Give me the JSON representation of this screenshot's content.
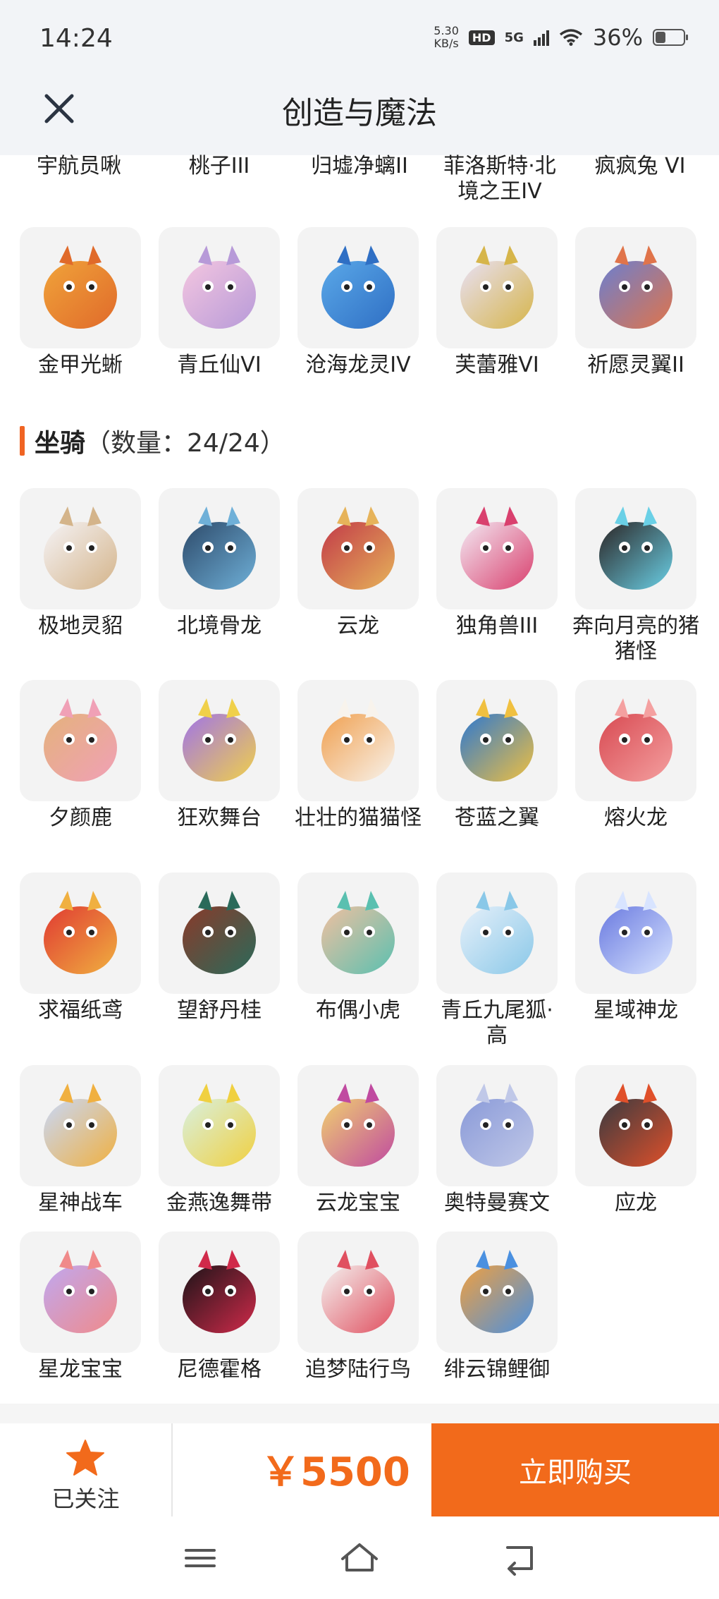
{
  "status_bar": {
    "time": "14:24",
    "net_speed_value": "5.30",
    "net_speed_unit": "KB/s",
    "hd": "HD",
    "network": "5G",
    "battery_pct": "36%",
    "battery_level": 0.36
  },
  "header": {
    "title": "创造与魔法"
  },
  "top_partial_labels": [
    "宇航员啾",
    "桃子III",
    "归墟净螭II",
    "菲洛斯特·北境之王IV",
    "疯疯兔 VI"
  ],
  "top_row": [
    {
      "label": "金甲光蜥",
      "icon": "golden-lizard-icon"
    },
    {
      "label": "青丘仙VI",
      "icon": "fox-fairy-icon"
    },
    {
      "label": "沧海龙灵IV",
      "icon": "sea-dragon-spirit-icon"
    },
    {
      "label": "芙蕾雅VI",
      "icon": "freya-icon"
    },
    {
      "label": "祈愿灵翼II",
      "icon": "griffin-icon"
    }
  ],
  "mounts_section": {
    "title": "坐骑",
    "count": "（数量：24/24）"
  },
  "mounts": [
    {
      "label": "极地灵貂",
      "icon": "polar-ferret-icon"
    },
    {
      "label": "北境骨龙",
      "icon": "bone-dragon-icon"
    },
    {
      "label": "云龙",
      "icon": "cloud-dragon-icon"
    },
    {
      "label": "独角兽III",
      "icon": "unicorn-icon"
    },
    {
      "label": "奔向月亮的猪猪怪",
      "icon": "pig-icon"
    },
    {
      "label": "夕颜鹿",
      "icon": "deer-icon"
    },
    {
      "label": "狂欢舞台",
      "icon": "carnival-stage-icon"
    },
    {
      "label": "壮壮的猫猫怪",
      "icon": "cat-icon"
    },
    {
      "label": "苍蓝之翼",
      "icon": "azure-wing-icon"
    },
    {
      "label": "熔火龙",
      "icon": "lava-dragon-icon"
    },
    {
      "label": "求福纸鸢",
      "icon": "kite-fish-icon"
    },
    {
      "label": "望舒丹桂",
      "icon": "swing-icon"
    },
    {
      "label": "布偶小虎",
      "icon": "tiger-icon"
    },
    {
      "label": "青丘九尾狐·高",
      "icon": "nine-tail-fox-icon"
    },
    {
      "label": "星域神龙",
      "icon": "star-dragon-icon"
    },
    {
      "label": "星神战车",
      "icon": "star-chariot-icon"
    },
    {
      "label": "金燕逸舞带",
      "icon": "swallow-ribbon-icon"
    },
    {
      "label": "云龙宝宝",
      "icon": "baby-cloud-dragon-icon"
    },
    {
      "label": "奥特曼赛文",
      "icon": "ultraman-icon"
    },
    {
      "label": "应龙",
      "icon": "ying-dragon-icon"
    },
    {
      "label": "星龙宝宝",
      "icon": "baby-star-dragon-icon"
    },
    {
      "label": "尼德霍格",
      "icon": "nidhogg-icon"
    },
    {
      "label": "追梦陆行鸟",
      "icon": "chocobo-icon"
    },
    {
      "label": "绯云锦鲤御",
      "icon": "koi-icon"
    }
  ],
  "bottom_bar": {
    "follow_label": "已关注",
    "price": "￥5500",
    "buy_label": "立即购买"
  },
  "colors": {
    "accent": "#f26a1b",
    "header_bg": "#f2f4f7",
    "thumb_bg": "#f3f3f3"
  }
}
